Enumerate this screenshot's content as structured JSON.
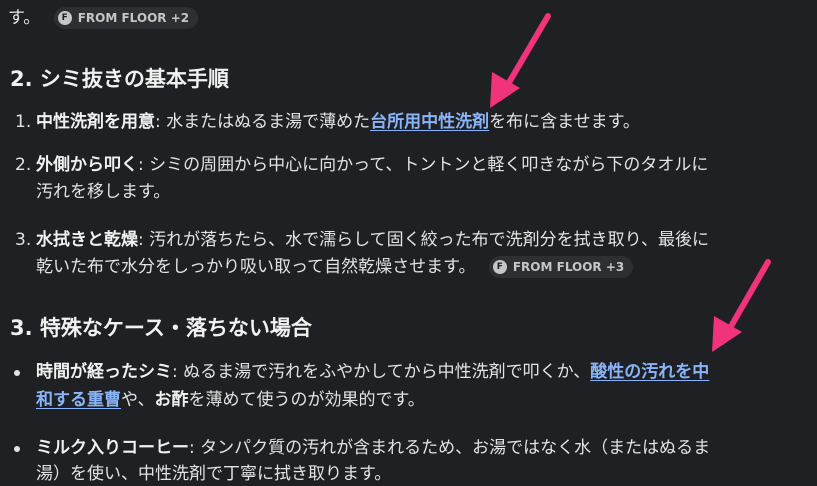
{
  "top": {
    "text": "す。",
    "chip": "FROM FLOOR +2"
  },
  "section2": {
    "heading": "2. シミ抜きの基本手順",
    "items": [
      {
        "num": "1.",
        "bold": "中性洗剤を用意",
        "pre": ": 水またはぬるま湯で薄めた",
        "link": "台所用中性洗剤",
        "post": "を布に含ませます。"
      },
      {
        "num": "2.",
        "bold": "外側から叩く",
        "line1": ": シミの周囲から中心に向かって、トントンと軽く叩きながら下のタオルに",
        "line2": "汚れを移します。"
      },
      {
        "num": "3.",
        "bold": "水拭きと乾燥",
        "line1": ": 汚れが落ちたら、水で濡らして固く絞った布で洗剤分を拭き取り、最後に",
        "line2": "乾いた布で水分をしっかり吸い取って自然乾燥させます。",
        "chip": "FROM FLOOR +3"
      }
    ]
  },
  "section3": {
    "heading": "3. 特殊なケース・落ちない場合",
    "items": [
      {
        "bold": "時間が経ったシミ",
        "line1": ": ぬるま湯で汚れをふやかしてから中性洗剤で叩くか、",
        "link1": "酸性の汚れを中",
        "link2": "和する重曹",
        "mid": "や、",
        "bold2": "お酢",
        "post": "を薄めて使うのが効果的です。"
      },
      {
        "bold": "ミルク入りコーヒー",
        "line1": ": タンパク質の汚れが含まれるため、お湯ではなく水（またはぬるま",
        "line2": "湯）を使い、中性洗剤で丁寧に拭き取ります。"
      }
    ]
  }
}
